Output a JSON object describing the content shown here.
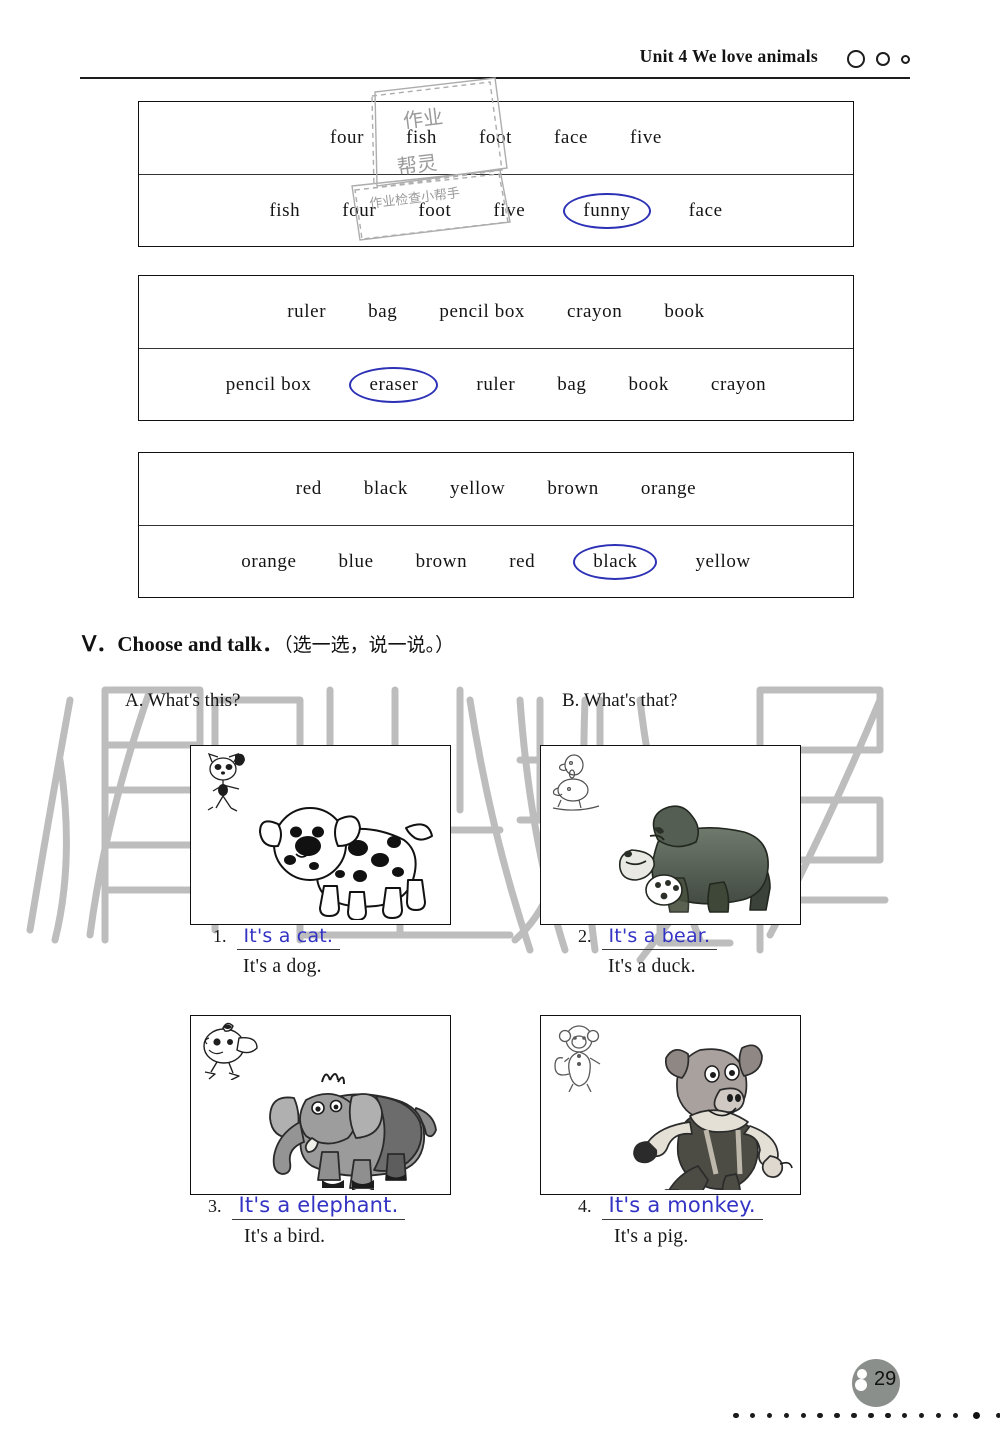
{
  "header": {
    "title": "Unit 4  We love animals",
    "dots": [
      "large-circle",
      "medium-circle",
      "small-circle"
    ]
  },
  "word_tables": [
    {
      "id": "table-numbers-and-face",
      "rows": [
        {
          "words": [
            {
              "text": "four",
              "circled": false
            },
            {
              "text": "fish",
              "circled": false
            },
            {
              "text": "foot",
              "circled": false
            },
            {
              "text": "face",
              "circled": false
            },
            {
              "text": "five",
              "circled": false
            }
          ]
        },
        {
          "words": [
            {
              "text": "fish",
              "circled": false
            },
            {
              "text": "four",
              "circled": false
            },
            {
              "text": "foot",
              "circled": false
            },
            {
              "text": "five",
              "circled": false
            },
            {
              "text": "funny",
              "circled": true
            },
            {
              "text": "face",
              "circled": false
            }
          ]
        }
      ]
    },
    {
      "id": "table-school-things",
      "rows": [
        {
          "words": [
            {
              "text": "ruler",
              "circled": false
            },
            {
              "text": "bag",
              "circled": false
            },
            {
              "text": "pencil box",
              "circled": false
            },
            {
              "text": "crayon",
              "circled": false
            },
            {
              "text": "book",
              "circled": false
            }
          ]
        },
        {
          "words": [
            {
              "text": "pencil box",
              "circled": false
            },
            {
              "text": "eraser",
              "circled": true
            },
            {
              "text": "ruler",
              "circled": false
            },
            {
              "text": "bag",
              "circled": false
            },
            {
              "text": "book",
              "circled": false
            },
            {
              "text": "crayon",
              "circled": false
            }
          ]
        }
      ]
    },
    {
      "id": "table-colours",
      "rows": [
        {
          "words": [
            {
              "text": "red",
              "circled": false
            },
            {
              "text": "black",
              "circled": false
            },
            {
              "text": "yellow",
              "circled": false
            },
            {
              "text": "brown",
              "circled": false
            },
            {
              "text": "orange",
              "circled": false
            }
          ]
        },
        {
          "words": [
            {
              "text": "orange",
              "circled": false
            },
            {
              "text": "blue",
              "circled": false
            },
            {
              "text": "brown",
              "circled": false
            },
            {
              "text": "red",
              "circled": false
            },
            {
              "text": "black",
              "circled": true
            },
            {
              "text": "yellow",
              "circled": false
            }
          ]
        }
      ]
    }
  ],
  "section": {
    "numeral": "Ⅴ．",
    "title_en": "Choose and talk．",
    "title_cn": "（选一选，说一说。）"
  },
  "exercise": {
    "group_a_label": "A. What's this?",
    "group_b_label": "B. What's that?",
    "items": [
      {
        "number": "1.",
        "written_answer": "It's a cat.",
        "printed_answer": "It's a dog.",
        "picture": "dalmatian-dog",
        "thumbnail": "cartoon-cat"
      },
      {
        "number": "2.",
        "written_answer": "It's a bear.",
        "printed_answer": "It's a duck.",
        "picture": "bear",
        "thumbnail": "duck-sketch"
      },
      {
        "number": "3.",
        "written_answer": "It's a elephant.",
        "printed_answer": "It's a bird.",
        "picture": "elephant",
        "thumbnail": "bird-sketch"
      },
      {
        "number": "4.",
        "written_answer": "It's a monkey.",
        "printed_answer": "It's a pig.",
        "picture": "dressed-pig",
        "thumbnail": "monkey-sketch"
      }
    ]
  },
  "footer": {
    "page_number": "29"
  },
  "watermark": {
    "large_text": "作业帮",
    "stamp_text_1": "作业帮灵",
    "stamp_text_2": "作业检查小帮手"
  },
  "colors": {
    "ink_blue": "#3333c4",
    "circle_blue": "#2c31b5",
    "text_black": "#161616",
    "watermark_gray": "#b9b9b9"
  }
}
